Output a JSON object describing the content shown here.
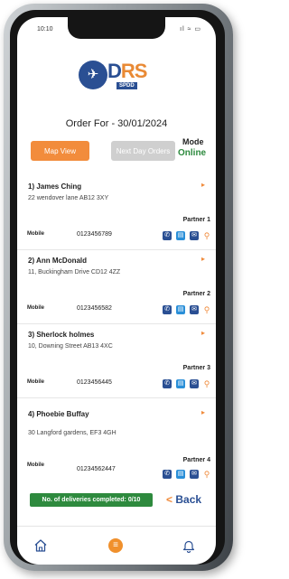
{
  "status_bar": {
    "time": "10:10",
    "icons": "ıl ≈ ▭"
  },
  "logo": {
    "letter_d": "D",
    "letters_rs": "RS",
    "sub": "SPDD"
  },
  "header": {
    "order_for": "Order For - 30/01/2024"
  },
  "buttons": {
    "map_view": "Map View",
    "next_day_orders": "Next Day Orders"
  },
  "mode": {
    "label": "Mode",
    "value": "Online"
  },
  "deliveries": [
    {
      "name": "1) James Ching",
      "address": "22 wendover lane AB12 3XY",
      "partner": "Partner 1",
      "mobile_label": "Mobile",
      "phone": "0123456789"
    },
    {
      "name": "2) Ann McDonald",
      "address": "11, Buckingham Drive CD12 4ZZ",
      "partner": "Partner 2",
      "mobile_label": "Mobile",
      "phone": "0123456582"
    },
    {
      "name": "3) Sherlock holmes",
      "address": "10, Downing Street AB13 4XC",
      "partner": "Partner 3",
      "mobile_label": "Mobile",
      "phone": "0123456445"
    },
    {
      "name": "4) Phoebie Buffay",
      "address": "30 Langford gardens, EF3 4GH",
      "partner": "Partner 4",
      "mobile_label": "Mobile",
      "phone": "01234562447"
    }
  ],
  "footer": {
    "completed": "No. of deliveries completed: 0/10",
    "back": "Back",
    "back_chevron": "<"
  },
  "icons": {
    "chevron": "▸",
    "phone": "✆",
    "chat": "▤",
    "mail": "✉",
    "pin": "⚲",
    "center_nav": "≡"
  },
  "colors": {
    "accent": "#f28c3c",
    "primary": "#2a4f93",
    "success": "#2e8a3e",
    "inactive": "#cfcfcf"
  }
}
